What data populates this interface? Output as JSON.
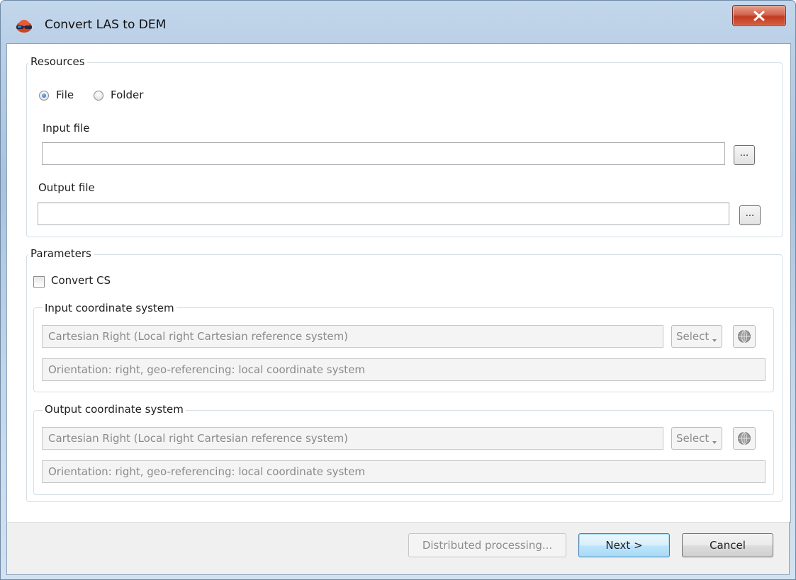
{
  "window": {
    "title": "Convert LAS to DEM",
    "close_icon": "close-x-icon",
    "app_icon": "app-logo-icon"
  },
  "resources": {
    "title": "Resources",
    "mode_options": [
      {
        "label": "File",
        "checked": true
      },
      {
        "label": "Folder",
        "checked": false
      }
    ],
    "input_file": {
      "label": "Input file",
      "value": "",
      "browse_label": "..."
    },
    "output_file": {
      "label": "Output file",
      "value": "",
      "browse_label": "..."
    }
  },
  "parameters": {
    "title": "Parameters",
    "convert_cs": {
      "label": "Convert CS",
      "checked": false
    },
    "input_cs": {
      "title": "Input coordinate system",
      "system": "Cartesian Right (Local right Cartesian reference system)",
      "description": "Orientation: right, geo-referencing: local coordinate system",
      "select_label": "Select",
      "globe_icon": "globe-icon"
    },
    "output_cs": {
      "title": "Output coordinate system",
      "system": "Cartesian Right (Local right Cartesian reference system)",
      "description": "Orientation: right, geo-referencing: local coordinate system",
      "select_label": "Select",
      "globe_icon": "globe-icon"
    }
  },
  "footer": {
    "distributed_label": "Distributed processing...",
    "next_label": "Next >",
    "cancel_label": "Cancel"
  },
  "colors": {
    "window_frame": "#bdd2e8",
    "close_button": "#c9452c",
    "default_button_border": "#3c7fb1"
  }
}
